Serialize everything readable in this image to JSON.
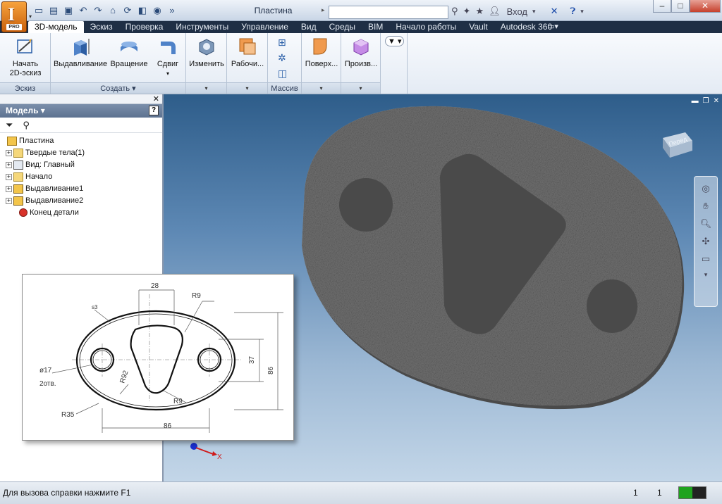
{
  "window": {
    "title": "Пластина",
    "login": "Вход",
    "pro_badge": "PRO"
  },
  "tabs": [
    {
      "label": "3D-модель",
      "active": true
    },
    {
      "label": "Эскиз"
    },
    {
      "label": "Проверка"
    },
    {
      "label": "Инструменты"
    },
    {
      "label": "Управление"
    },
    {
      "label": "Вид"
    },
    {
      "label": "Среды"
    },
    {
      "label": "BIM"
    },
    {
      "label": "Начало работы"
    },
    {
      "label": "Vault"
    },
    {
      "label": "Autodesk 360"
    }
  ],
  "ribbon": {
    "start_sketch_1": "Начать",
    "start_sketch_2": "2D-эскиз",
    "extrude": "Выдавливание",
    "revolve": "Вращение",
    "sweep": "Сдвиг",
    "modify": "Изменить",
    "work": "Рабочи...",
    "surface": "Поверх...",
    "derive": "Произв...",
    "panel_sketch": "Эскиз",
    "panel_create": "Создать",
    "panel_pattern": "Массив"
  },
  "browser": {
    "header": "Модель",
    "items": [
      {
        "label": "Пластина"
      },
      {
        "label": "Твердые тела(1)"
      },
      {
        "label": "Вид: Главный"
      },
      {
        "label": "Начало"
      },
      {
        "label": "Выдавливание1"
      },
      {
        "label": "Выдавливание2"
      },
      {
        "label": "Конец детали"
      }
    ]
  },
  "viewcube_label": "Перед",
  "axis_label_x": "X",
  "drawing": {
    "dim_28": "28",
    "dim_r9_top": "R9",
    "dim_s3": "s3",
    "dim_37": "37",
    "dim_86_v": "86",
    "dim_d17": "ø17",
    "dim_2otv": "2отв.",
    "dim_r92": "R92",
    "dim_r9_bot": "R9",
    "dim_r35": "R35",
    "dim_86_h": "86"
  },
  "status": {
    "help_text": "Для вызова справки нажмите F1",
    "count_1": "1",
    "count_2": "1",
    "progress": 0.5
  },
  "colors": {
    "menubar": "#1f2f45",
    "viewport_top": "#2e5d8a",
    "viewport_bottom": "#c3d6e8",
    "part": "#6e6e6e"
  }
}
